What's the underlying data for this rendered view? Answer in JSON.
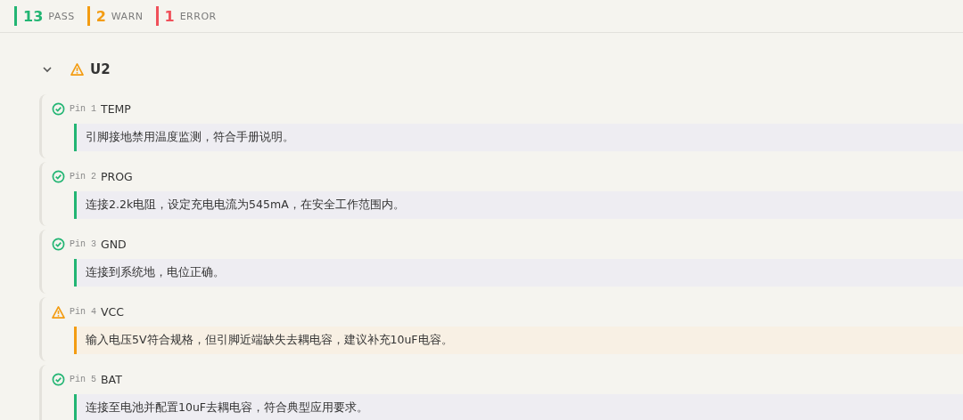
{
  "summary": [
    {
      "count": "13",
      "label": "PASS",
      "color": "#22b573"
    },
    {
      "count": "2",
      "label": "WARN",
      "color": "#f39c12"
    },
    {
      "count": "1",
      "label": "ERROR",
      "color": "#f0505a"
    }
  ],
  "group": {
    "name": "U2",
    "kind": "warn",
    "expanded": true,
    "pins": [
      {
        "pin": "Pin 1",
        "name": "TEMP",
        "kind": "pass",
        "note": "引脚接地禁用温度监测，符合手册说明。"
      },
      {
        "pin": "Pin 2",
        "name": "PROG",
        "kind": "pass",
        "note": "连接2.2k电阻，设定充电电流为545mA，在安全工作范围内。"
      },
      {
        "pin": "Pin 3",
        "name": "GND",
        "kind": "pass",
        "note": "连接到系统地，电位正确。"
      },
      {
        "pin": "Pin 4",
        "name": "VCC",
        "kind": "warn",
        "note": "输入电压5V符合规格，但引脚近端缺失去耦电容，建议补充10uF电容。"
      },
      {
        "pin": "Pin 5",
        "name": "BAT",
        "kind": "pass",
        "note": "连接至电池并配置10uF去耦电容，符合典型应用要求。"
      }
    ]
  }
}
